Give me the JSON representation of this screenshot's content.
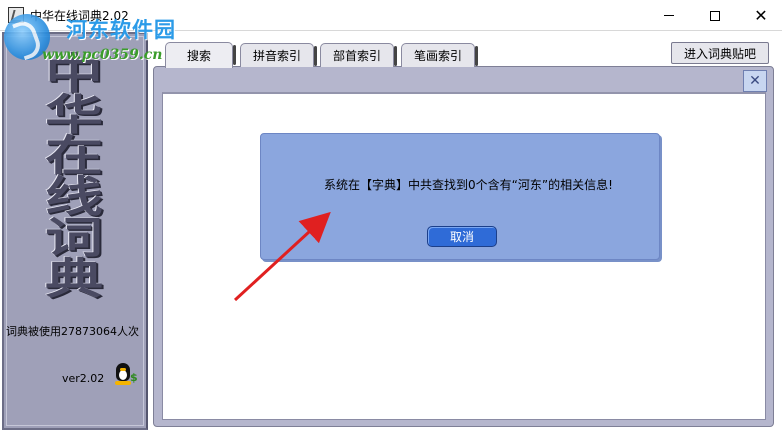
{
  "window": {
    "title": "中华在线词典2.02",
    "minimize_glyph": "—",
    "close_glyph": "✕"
  },
  "watermark": {
    "site_name": "河东软件园",
    "url": "www.pc0359.cn"
  },
  "left_panel": {
    "title_chars": [
      "中",
      "华",
      "在",
      "线",
      "词",
      "典"
    ],
    "usage_text": "词典被使用27873064人次",
    "version": "ver2.02"
  },
  "tabs": [
    {
      "label": "搜索",
      "selected": true
    },
    {
      "label": "拼音索引",
      "selected": false
    },
    {
      "label": "部首索引",
      "selected": false
    },
    {
      "label": "笔画索引",
      "selected": false
    }
  ],
  "toolbar": {
    "forum_button_label": "进入词典贴吧"
  },
  "content": {
    "close_glyph": "✕"
  },
  "dialog": {
    "message": "系统在【字典】中共查找到0个含有“河东”的相关信息!",
    "cancel_label": "取消"
  },
  "colors": {
    "panel_bg": "#9fa0b8",
    "dialog_bg": "#8ba6de",
    "button_blue": "#2f6bd7",
    "arrow_red": "#e02020"
  }
}
